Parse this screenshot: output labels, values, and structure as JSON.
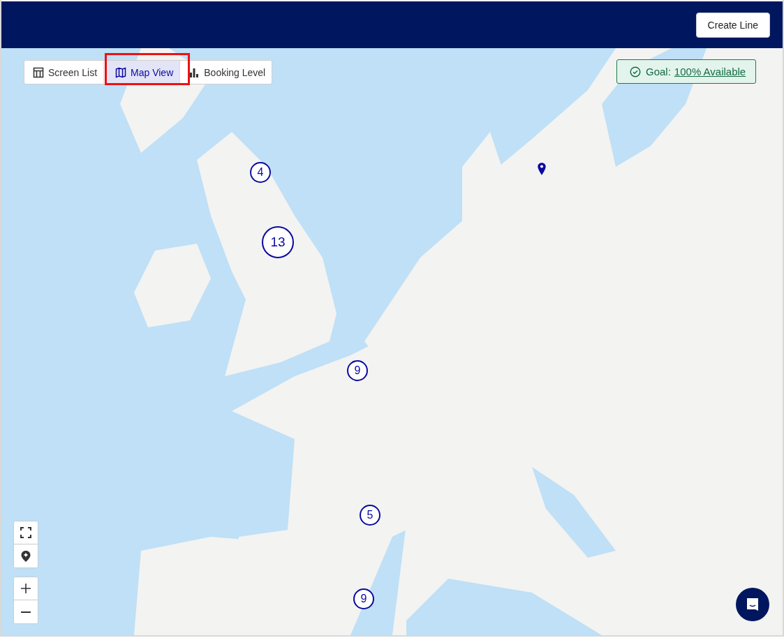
{
  "header": {
    "create_button": "Create Line"
  },
  "view_tabs": [
    {
      "label": "Screen List",
      "selected": false,
      "kind": "table"
    },
    {
      "label": "Map View",
      "selected": true,
      "kind": "map"
    },
    {
      "label": "Booking Level",
      "selected": false,
      "kind": "chart"
    }
  ],
  "goal": {
    "label": "Goal:",
    "link": "100% Available"
  },
  "map": {
    "kind": "picture",
    "clusters": [
      {
        "count": "4"
      },
      {
        "count": "13"
      },
      {
        "count": "9"
      },
      {
        "count": "5"
      },
      {
        "count": "9"
      }
    ],
    "pins": [
      {
        "kind": "pin"
      }
    ]
  }
}
